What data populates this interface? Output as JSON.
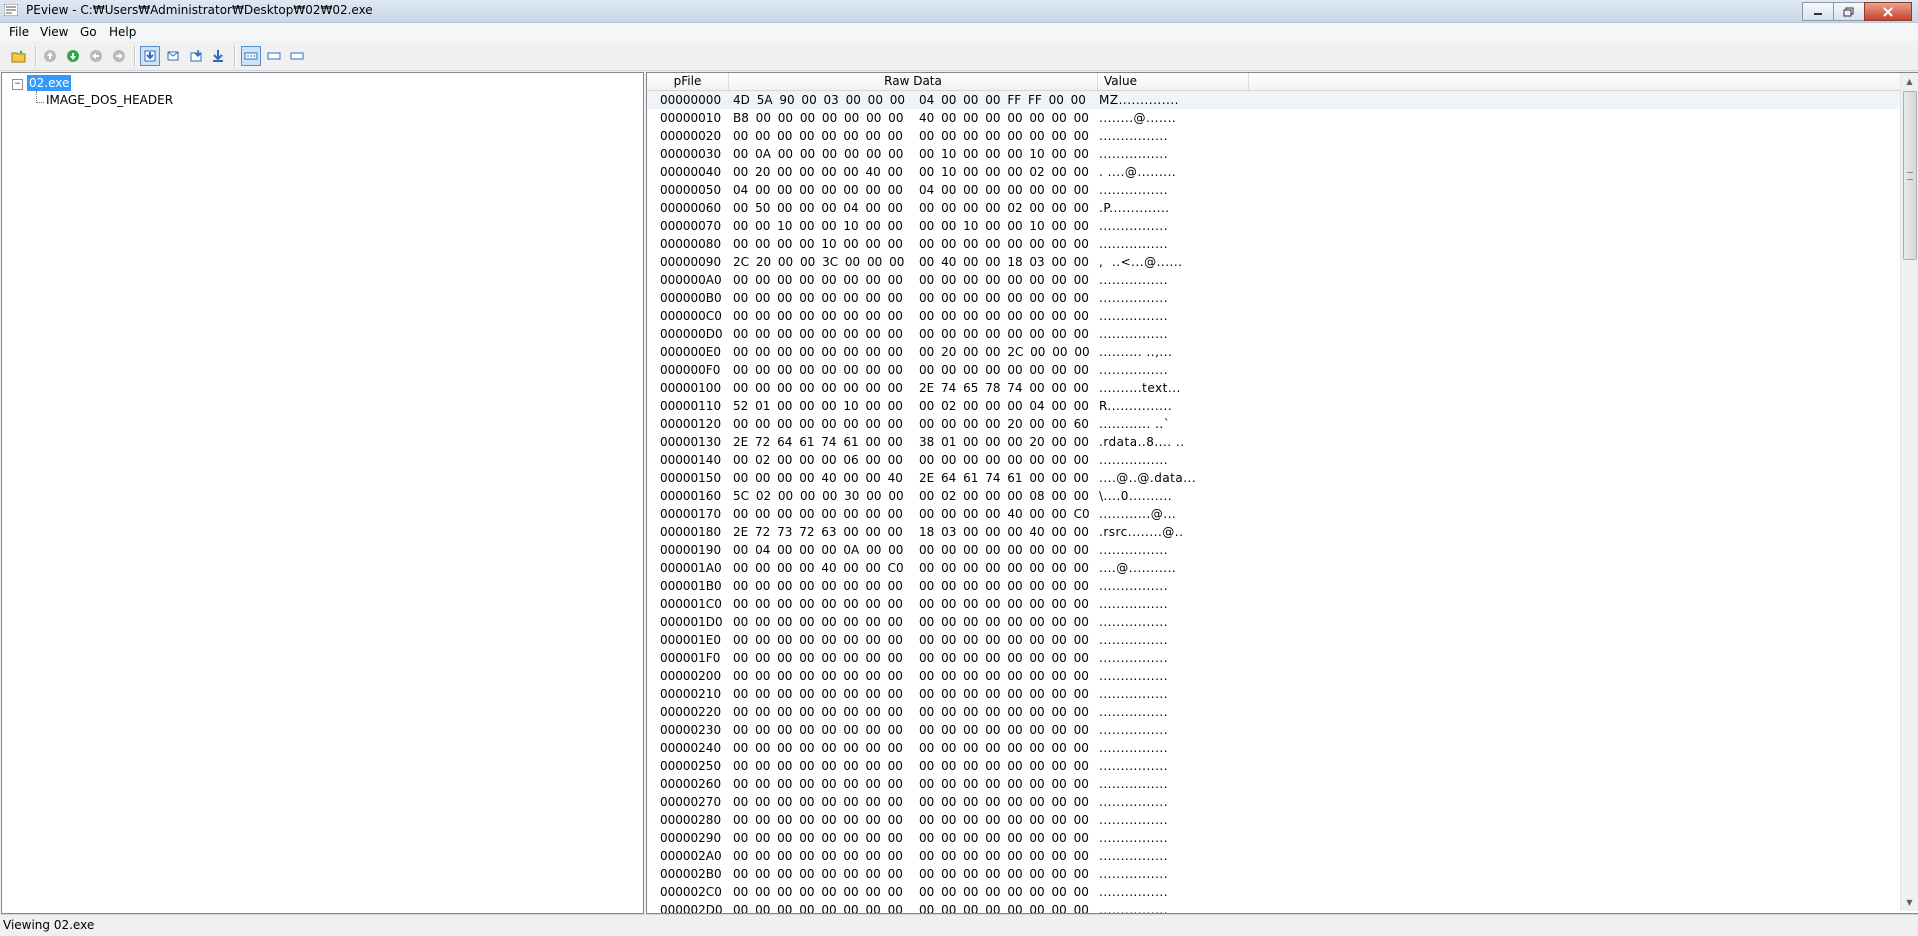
{
  "window": {
    "title": "PEview - C:₩Users₩Administrator₩Desktop₩02₩02.exe"
  },
  "menu": [
    "File",
    "View",
    "Go",
    "Help"
  ],
  "tree": {
    "root_label": "02.exe",
    "expander": "−",
    "children": [
      "IMAGE_DOS_HEADER"
    ]
  },
  "table": {
    "headers": {
      "offset": "pFile",
      "raw": "Raw Data",
      "value": "Value"
    },
    "rows": [
      {
        "offset": "00000000",
        "hex1": "4D 5A 90 00 03 00 00 00",
        "hex2": "04 00 00 00 FF FF 00 00",
        "ascii": "MZ.............."
      },
      {
        "offset": "00000010",
        "hex1": "B8 00 00 00 00 00 00 00",
        "hex2": "40 00 00 00 00 00 00 00",
        "ascii": "........@......."
      },
      {
        "offset": "00000020",
        "hex1": "00 00 00 00 00 00 00 00",
        "hex2": "00 00 00 00 00 00 00 00",
        "ascii": "................"
      },
      {
        "offset": "00000030",
        "hex1": "00 0A 00 00 00 00 00 00",
        "hex2": "00 10 00 00 00 10 00 00",
        "ascii": "................"
      },
      {
        "offset": "00000040",
        "hex1": "00 20 00 00 00 00 40 00",
        "hex2": "00 10 00 00 00 02 00 00",
        "ascii": ". ....@........."
      },
      {
        "offset": "00000050",
        "hex1": "04 00 00 00 00 00 00 00",
        "hex2": "04 00 00 00 00 00 00 00",
        "ascii": "................"
      },
      {
        "offset": "00000060",
        "hex1": "00 50 00 00 00 04 00 00",
        "hex2": "00 00 00 00 02 00 00 00",
        "ascii": ".P.............."
      },
      {
        "offset": "00000070",
        "hex1": "00 00 10 00 00 10 00 00",
        "hex2": "00 00 10 00 00 10 00 00",
        "ascii": "................"
      },
      {
        "offset": "00000080",
        "hex1": "00 00 00 00 10 00 00 00",
        "hex2": "00 00 00 00 00 00 00 00",
        "ascii": "................"
      },
      {
        "offset": "00000090",
        "hex1": "2C 20 00 00 3C 00 00 00",
        "hex2": "00 40 00 00 18 03 00 00",
        ",  ..<....@......": "",
        "ascii": ",  ..<...@......"
      },
      {
        "offset": "000000A0",
        "hex1": "00 00 00 00 00 00 00 00",
        "hex2": "00 00 00 00 00 00 00 00",
        "ascii": "................"
      },
      {
        "offset": "000000B0",
        "hex1": "00 00 00 00 00 00 00 00",
        "hex2": "00 00 00 00 00 00 00 00",
        "ascii": "................"
      },
      {
        "offset": "000000C0",
        "hex1": "00 00 00 00 00 00 00 00",
        "hex2": "00 00 00 00 00 00 00 00",
        "ascii": "................"
      },
      {
        "offset": "000000D0",
        "hex1": "00 00 00 00 00 00 00 00",
        "hex2": "00 00 00 00 00 00 00 00",
        "ascii": "................"
      },
      {
        "offset": "000000E0",
        "hex1": "00 00 00 00 00 00 00 00",
        "hex2": "00 20 00 00 2C 00 00 00",
        "ascii": ".......... ..,..."
      },
      {
        "offset": "000000F0",
        "hex1": "00 00 00 00 00 00 00 00",
        "hex2": "00 00 00 00 00 00 00 00",
        "ascii": "................"
      },
      {
        "offset": "00000100",
        "hex1": "00 00 00 00 00 00 00 00",
        "hex2": "2E 74 65 78 74 00 00 00",
        "ascii": "..........text..."
      },
      {
        "offset": "00000110",
        "hex1": "52 01 00 00 00 10 00 00",
        "hex2": "00 02 00 00 00 04 00 00",
        "ascii": "R..............."
      },
      {
        "offset": "00000120",
        "hex1": "00 00 00 00 00 00 00 00",
        "hex2": "00 00 00 00 20 00 00 60",
        "ascii": "............ ..`"
      },
      {
        "offset": "00000130",
        "hex1": "2E 72 64 61 74 61 00 00",
        "hex2": "38 01 00 00 00 20 00 00",
        "ascii": ".rdata..8.... .."
      },
      {
        "offset": "00000140",
        "hex1": "00 02 00 00 00 06 00 00",
        "hex2": "00 00 00 00 00 00 00 00",
        "ascii": "................"
      },
      {
        "offset": "00000150",
        "hex1": "00 00 00 00 40 00 00 40",
        "hex2": "2E 64 61 74 61 00 00 00",
        "ascii": "....@..@.data..."
      },
      {
        "offset": "00000160",
        "hex1": "5C 02 00 00 00 30 00 00",
        "hex2": "00 02 00 00 00 08 00 00",
        "ascii": "\\....0.........."
      },
      {
        "offset": "00000170",
        "hex1": "00 00 00 00 00 00 00 00",
        "hex2": "00 00 00 00 40 00 00 C0",
        "ascii": "............@..."
      },
      {
        "offset": "00000180",
        "hex1": "2E 72 73 72 63 00 00 00",
        "hex2": "18 03 00 00 00 40 00 00",
        "ascii": ".rsrc........@.."
      },
      {
        "offset": "00000190",
        "hex1": "00 04 00 00 00 0A 00 00",
        "hex2": "00 00 00 00 00 00 00 00",
        "ascii": "................"
      },
      {
        "offset": "000001A0",
        "hex1": "00 00 00 00 40 00 00 C0",
        "hex2": "00 00 00 00 00 00 00 00",
        "ascii": "....@..........."
      },
      {
        "offset": "000001B0",
        "hex1": "00 00 00 00 00 00 00 00",
        "hex2": "00 00 00 00 00 00 00 00",
        "ascii": "................"
      },
      {
        "offset": "000001C0",
        "hex1": "00 00 00 00 00 00 00 00",
        "hex2": "00 00 00 00 00 00 00 00",
        "ascii": "................"
      },
      {
        "offset": "000001D0",
        "hex1": "00 00 00 00 00 00 00 00",
        "hex2": "00 00 00 00 00 00 00 00",
        "ascii": "................"
      },
      {
        "offset": "000001E0",
        "hex1": "00 00 00 00 00 00 00 00",
        "hex2": "00 00 00 00 00 00 00 00",
        "ascii": "................"
      },
      {
        "offset": "000001F0",
        "hex1": "00 00 00 00 00 00 00 00",
        "hex2": "00 00 00 00 00 00 00 00",
        "ascii": "................"
      },
      {
        "offset": "00000200",
        "hex1": "00 00 00 00 00 00 00 00",
        "hex2": "00 00 00 00 00 00 00 00",
        "ascii": "................"
      },
      {
        "offset": "00000210",
        "hex1": "00 00 00 00 00 00 00 00",
        "hex2": "00 00 00 00 00 00 00 00",
        "ascii": "................"
      },
      {
        "offset": "00000220",
        "hex1": "00 00 00 00 00 00 00 00",
        "hex2": "00 00 00 00 00 00 00 00",
        "ascii": "................"
      },
      {
        "offset": "00000230",
        "hex1": "00 00 00 00 00 00 00 00",
        "hex2": "00 00 00 00 00 00 00 00",
        "ascii": "................"
      },
      {
        "offset": "00000240",
        "hex1": "00 00 00 00 00 00 00 00",
        "hex2": "00 00 00 00 00 00 00 00",
        "ascii": "................"
      },
      {
        "offset": "00000250",
        "hex1": "00 00 00 00 00 00 00 00",
        "hex2": "00 00 00 00 00 00 00 00",
        "ascii": "................"
      },
      {
        "offset": "00000260",
        "hex1": "00 00 00 00 00 00 00 00",
        "hex2": "00 00 00 00 00 00 00 00",
        "ascii": "................"
      },
      {
        "offset": "00000270",
        "hex1": "00 00 00 00 00 00 00 00",
        "hex2": "00 00 00 00 00 00 00 00",
        "ascii": "................"
      },
      {
        "offset": "00000280",
        "hex1": "00 00 00 00 00 00 00 00",
        "hex2": "00 00 00 00 00 00 00 00",
        "ascii": "................"
      },
      {
        "offset": "00000290",
        "hex1": "00 00 00 00 00 00 00 00",
        "hex2": "00 00 00 00 00 00 00 00",
        "ascii": "................"
      },
      {
        "offset": "000002A0",
        "hex1": "00 00 00 00 00 00 00 00",
        "hex2": "00 00 00 00 00 00 00 00",
        "ascii": "................"
      },
      {
        "offset": "000002B0",
        "hex1": "00 00 00 00 00 00 00 00",
        "hex2": "00 00 00 00 00 00 00 00",
        "ascii": "................"
      },
      {
        "offset": "000002C0",
        "hex1": "00 00 00 00 00 00 00 00",
        "hex2": "00 00 00 00 00 00 00 00",
        "ascii": "................"
      },
      {
        "offset": "000002D0",
        "hex1": "00 00 00 00 00 00 00 00",
        "hex2": "00 00 00 00 00 00 00 00",
        "ascii": "................"
      }
    ]
  },
  "status": "Viewing 02.exe",
  "colors": {
    "selection": "#3399ff",
    "accent": "#5a8ec7"
  }
}
